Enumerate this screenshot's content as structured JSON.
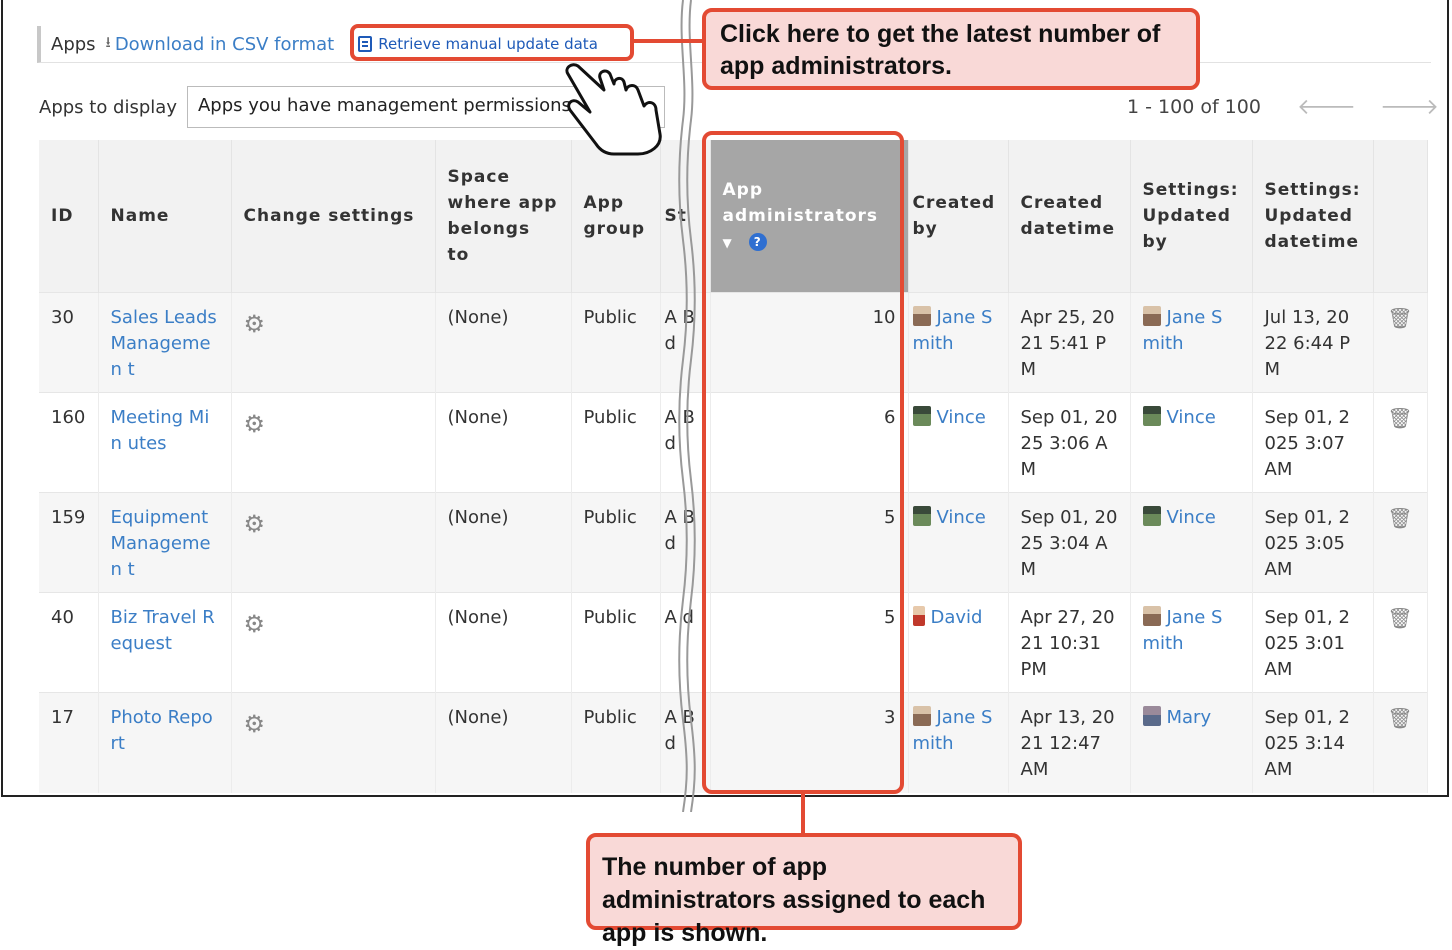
{
  "header": {
    "title": "Apps",
    "download_label": "Download in CSV format",
    "retrieve_label": "Retrieve manual update data"
  },
  "filter": {
    "label": "Apps to display",
    "selected": "Apps you have management permissions"
  },
  "pager": {
    "range_text": "1 - 100 of 100",
    "prev": "🡐",
    "next": "🡒"
  },
  "table": {
    "columns": {
      "id": "ID",
      "name": "Name",
      "change_settings": "Change settings",
      "space": "Space where app belongs to",
      "app_group": "App group",
      "status": "St",
      "app_admins": "App administrators",
      "created_by": "Created by",
      "created_datetime": "Created datetime",
      "updated_by": "Settings: Updated by",
      "updated_datetime": "Settings: Updated datetime"
    },
    "rows": [
      {
        "id": "30",
        "name": "Sales Leads Managemen t",
        "space": "(None)",
        "group": "Public",
        "status": "A B d",
        "admins": "10",
        "created_by": "Jane S mith",
        "created_by_avatar": "jane",
        "created": "Apr 25, 2021 5:41 PM",
        "updated_by": "Jane S mith",
        "updated_by_avatar": "jane",
        "updated": "Jul 13, 2022 6:44 PM"
      },
      {
        "id": "160",
        "name": "Meeting Min utes",
        "space": "(None)",
        "group": "Public",
        "status": "A B d",
        "admins": "6",
        "created_by": "Vince",
        "created_by_avatar": "vince",
        "created": "Sep 01, 2025 3:06 AM",
        "updated_by": "Vince",
        "updated_by_avatar": "vince",
        "updated": "Sep 01, 2025 3:07 AM"
      },
      {
        "id": "159",
        "name": "Equipment Managemen t",
        "space": "(None)",
        "group": "Public",
        "status": "A B d",
        "admins": "5",
        "created_by": "Vince",
        "created_by_avatar": "vince",
        "created": "Sep 01, 2025 3:04 AM",
        "updated_by": "Vince",
        "updated_by_avatar": "vince",
        "updated": "Sep 01, 2025 3:05 AM"
      },
      {
        "id": "40",
        "name": "Biz Travel R equest",
        "space": "(None)",
        "group": "Public",
        "status": "A d",
        "admins": "5",
        "created_by": "David",
        "created_by_avatar": "david",
        "created": "Apr 27, 2021 10:31 PM",
        "updated_by": "Jane S mith",
        "updated_by_avatar": "jane",
        "updated": "Sep 01, 2025 3:01 AM"
      },
      {
        "id": "17",
        "name": "Photo Repo rt",
        "space": "(None)",
        "group": "Public",
        "status": "A B d",
        "admins": "3",
        "created_by": "Jane S mith",
        "created_by_avatar": "jane",
        "created": "Apr 13, 2021 12:47 AM",
        "updated_by": "Mary",
        "updated_by_avatar": "mary",
        "updated": "Sep 01, 2025 3:14 AM"
      }
    ]
  },
  "callouts": {
    "top": "Click here to get the latest number of app administrators.",
    "bottom": "The number of app administrators assigned to each app is shown."
  },
  "icons": {
    "download": "download-icon",
    "retrieve": "document-refresh-icon",
    "gear": "gear-icon",
    "trash": "trash-icon",
    "help": "help-icon",
    "sort": "sort-descending-icon",
    "pointer": "pointing-hand-icon"
  },
  "colors": {
    "link": "#3b7ec6",
    "highlight": "#e34a33",
    "callout_bg": "#f9d9d7",
    "sorted_header": "#a6a6a6"
  }
}
